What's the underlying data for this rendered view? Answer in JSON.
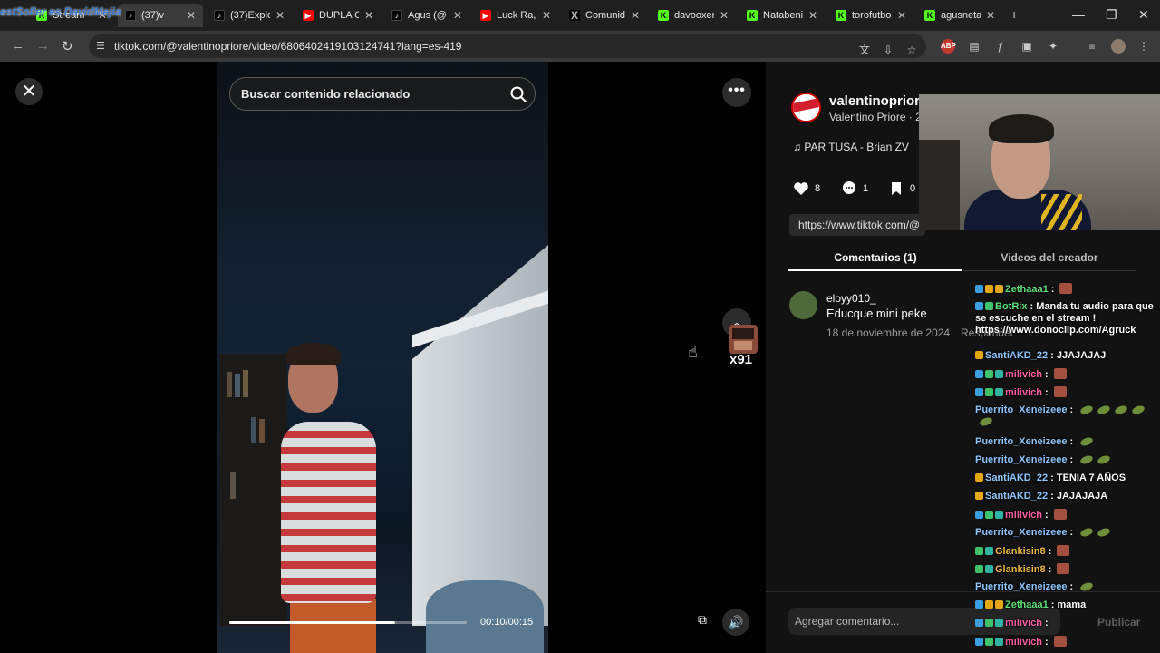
{
  "browser": {
    "tabs": [
      {
        "label": "Stream",
        "icon": "kick-icon"
      },
      {
        "label": "(37)v",
        "icon": "tiktok-icon",
        "active": true
      },
      {
        "label": "(37)Explo",
        "icon": "tiktok-icon"
      },
      {
        "label": "DUPLA C",
        "icon": "youtube-icon"
      },
      {
        "label": "Agus (@",
        "icon": "tiktok-icon"
      },
      {
        "label": "Luck Ra, ",
        "icon": "youtube-icon"
      },
      {
        "label": "Comunid",
        "icon": "x-icon"
      },
      {
        "label": "davooxen",
        "icon": "kick-icon"
      },
      {
        "label": "Natabeni",
        "icon": "kick-icon"
      },
      {
        "label": "torofutbo",
        "icon": "kick-icon"
      },
      {
        "label": "agusneta",
        "icon": "kick-icon"
      }
    ],
    "url": "tiktok.com/@valentinopriore/video/6806402419103124741?lang=es-419"
  },
  "watermark": "estSoller es DavidMejia",
  "video": {
    "search_placeholder": "Buscar contenido relacionado",
    "timecode": "00:10/00:15",
    "progress": 0.7,
    "emote_count": "x91"
  },
  "panel": {
    "username": "valentinoprior",
    "display_name": "Valentino Priore · 2",
    "music": "PAR TUSA - Brian ZV",
    "likes": "8",
    "comments": "1",
    "saves": "0",
    "link": "https://www.tiktok.com/@",
    "tabs": {
      "comments": "Comentarios (1)",
      "creator": "Videos del creador"
    },
    "comment": {
      "user": "eloyy010_",
      "text": "Educque mini peke",
      "date": "18 de noviembre de 2024",
      "reply": "Responder"
    },
    "input_placeholder": "Agregar comentario...",
    "publish": "Publicar"
  },
  "chat": [
    {
      "user": "Zethaaa1",
      "color": "#5ce27a",
      "text": "",
      "badges": [
        "b-blue",
        "b-gold",
        "b-gold"
      ],
      "emotes": [
        "sq"
      ]
    },
    {
      "user": "BotRix",
      "color": "#5ce27a",
      "text": "Manda tu audio para que se escuche en el stream ! https://www.donoclip.com/Agruck",
      "badges": [
        "b-blue",
        "b-green"
      ],
      "emotes": []
    },
    {
      "user": "SantiAKD_22",
      "color": "#8ec6ff",
      "text": "JJAJAJAJ",
      "badges": [
        "b-gold"
      ],
      "emotes": []
    },
    {
      "user": "milivich",
      "color": "#ff5fa2",
      "text": "",
      "badges": [
        "b-blue",
        "b-green",
        "b-teal"
      ],
      "emotes": [
        "sq"
      ]
    },
    {
      "user": "milivich",
      "color": "#ff5fa2",
      "text": "",
      "badges": [
        "b-blue",
        "b-green",
        "b-teal"
      ],
      "emotes": [
        "sq"
      ]
    },
    {
      "user": "Puerrito_Xeneizeee",
      "color": "#8ec6ff",
      "text": "",
      "badges": [],
      "emotes": [
        "leaf",
        "leaf",
        "leaf",
        "leaf",
        "leaf"
      ]
    },
    {
      "user": "Puerrito_Xeneizeee",
      "color": "#8ec6ff",
      "text": "",
      "badges": [],
      "emotes": [
        "leaf"
      ]
    },
    {
      "user": "Puerrito_Xeneizeee",
      "color": "#8ec6ff",
      "text": "",
      "badges": [],
      "emotes": [
        "leaf",
        "leaf"
      ]
    },
    {
      "user": "SantiAKD_22",
      "color": "#8ec6ff",
      "text": "TENIA 7 AÑOS",
      "badges": [
        "b-gold"
      ],
      "emotes": []
    },
    {
      "user": "SantiAKD_22",
      "color": "#8ec6ff",
      "text": "JAJAJAJA",
      "badges": [
        "b-gold"
      ],
      "emotes": []
    },
    {
      "user": "milivich",
      "color": "#ff5fa2",
      "text": "",
      "badges": [
        "b-blue",
        "b-green",
        "b-teal"
      ],
      "emotes": [
        "sq"
      ]
    },
    {
      "user": "Puerrito_Xeneizeee",
      "color": "#8ec6ff",
      "text": "",
      "badges": [],
      "emotes": [
        "leaf",
        "leaf"
      ]
    },
    {
      "user": "Glankisin8",
      "color": "#f2b73d",
      "text": "",
      "badges": [
        "b-green",
        "b-teal"
      ],
      "emotes": [
        "sq"
      ]
    },
    {
      "user": "Glankisin8",
      "color": "#f2b73d",
      "text": "",
      "badges": [
        "b-green",
        "b-teal"
      ],
      "emotes": [
        "sq"
      ]
    },
    {
      "user": "Puerrito_Xeneizeee",
      "color": "#8ec6ff",
      "text": "",
      "badges": [],
      "emotes": [
        "leaf"
      ]
    },
    {
      "user": "Zethaaa1",
      "color": "#5ce27a",
      "text": "mama",
      "badges": [
        "b-blue",
        "b-gold",
        "b-gold"
      ],
      "emotes": []
    },
    {
      "user": "milivich",
      "color": "#ff5fa2",
      "text": "",
      "badges": [
        "b-blue",
        "b-green",
        "b-teal"
      ],
      "emotes": []
    },
    {
      "user": "milivich",
      "color": "#ff5fa2",
      "text": "",
      "badges": [
        "b-blue",
        "b-green",
        "b-teal"
      ],
      "emotes": [
        "sq"
      ]
    }
  ]
}
